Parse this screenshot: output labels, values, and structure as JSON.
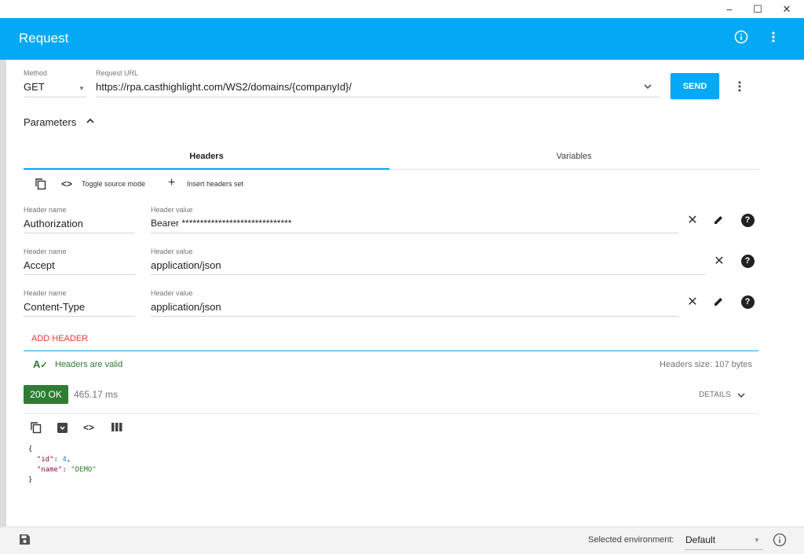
{
  "window": {
    "minimize": "–",
    "maximize": "☐",
    "close": "✕"
  },
  "appbar": {
    "title": "Request",
    "info_icon": "info-icon",
    "menu_icon": "more-vert-icon"
  },
  "request": {
    "method_label": "Method",
    "method_value": "GET",
    "url_label": "Request URL",
    "url_value": "https://rpa.casthighlight.com/WS2/domains/{companyId}/",
    "send_label": "SEND"
  },
  "parameters": {
    "label": "Parameters",
    "tabs": [
      "Headers",
      "Variables"
    ],
    "active_tab": 0,
    "toolbar": {
      "toggle_source": "Toggle source mode",
      "insert_headers": "Insert headers set"
    },
    "headers": [
      {
        "name_label": "Header name",
        "name": "Authorization",
        "value_label": "Header value",
        "value": "Bearer ******************************",
        "editable": true
      },
      {
        "name_label": "Header name",
        "name": "Accept",
        "value_label": "Header value",
        "value": "application/json",
        "editable": false
      },
      {
        "name_label": "Header name",
        "name": "Content-Type",
        "value_label": "Header value",
        "value": "application/json",
        "editable": true
      }
    ],
    "add_header": "ADD HEADER",
    "valid_text": "Headers are valid",
    "size_text": "Headers size: 107 bytes"
  },
  "response": {
    "status": "200 OK",
    "time": "465.17 ms",
    "details": "DETAILS",
    "json_open": "{",
    "json_close": "}",
    "fields": [
      {
        "key": "\"id\"",
        "value": "4",
        "type": "number"
      },
      {
        "key": "\"name\"",
        "value": "\"DEMO\"",
        "type": "string"
      }
    ]
  },
  "bottom": {
    "env_label": "Selected environment:",
    "env_value": "Default"
  },
  "colors": {
    "primary": "#03a9f4",
    "success": "#2e7d32",
    "accent_red": "#e53935"
  }
}
